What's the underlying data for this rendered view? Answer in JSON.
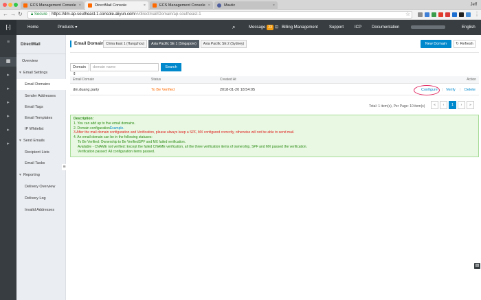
{
  "browser": {
    "tabs": [
      {
        "label": "ECS Management Console",
        "active": false
      },
      {
        "label": "DirectMail Console",
        "active": true
      },
      {
        "label": "ECS Management Console",
        "active": false
      },
      {
        "label": "Mautic",
        "active": false
      }
    ],
    "user": "Jeff",
    "secure_label": "Secure",
    "url_host": "https://dm-ap-southeast-1.console.aliyun.com",
    "url_path": "/#/directmail/Domain/ap-southeast-1"
  },
  "topnav": {
    "home": "Home",
    "products": "Products",
    "message": "Message",
    "message_count": "23",
    "billing": "Billing Management",
    "support": "Support",
    "icp": "ICP",
    "documentation": "Documentation",
    "language": "English"
  },
  "sidebar": {
    "title": "DirectMail",
    "overview": "Overview",
    "email_settings": "Email Settings",
    "email_domains": "Email Domains",
    "sender_addresses": "Sender Addresses",
    "email_tags": "Email Tags",
    "email_templates": "Email Templates",
    "ip_whitelist": "IP Whitelist",
    "send_emails": "Send Emails",
    "recipient_lists": "Recipient Lists",
    "email_tasks": "Email Tasks",
    "reporting": "Reporting",
    "delivery_overview": "Delivery Overview",
    "delivery_log": "Delivery Log",
    "invalid_addresses": "Invalid Addresses"
  },
  "main": {
    "title": "Email Domains",
    "regions": [
      {
        "label": "China East 1 (Hangzhou)",
        "active": false
      },
      {
        "label": "Asia Pacific SE 1 (Singapore)",
        "active": true
      },
      {
        "label": "Asia Pacific SE 2 (Sydney)",
        "active": false
      }
    ],
    "new_domain": "New Domain",
    "refresh": "Refresh",
    "search": {
      "field": "Domain",
      "placeholder": "domain name",
      "value": "",
      "button": "Search"
    },
    "table": {
      "headers": {
        "domain": "Email Domain",
        "status": "Status",
        "created": "Created At",
        "action": "Action"
      },
      "rows": [
        {
          "domain": "dm.duang.party",
          "status": "To Be Verified",
          "created": "2018-01-20 18:54:05",
          "configure": "Configure",
          "verify": "Verify",
          "delete": "Delete"
        }
      ]
    },
    "pagination": {
      "info": "Total: 1 item(s),   Per Page: 10 item(s)",
      "first": "«",
      "prev": "‹",
      "current": "1",
      "next": "›",
      "last": "»"
    },
    "description": {
      "title": "Description:",
      "line1": "1. You can add up to five email domains.",
      "line2_prefix": "2. Domain configuration",
      "line2_link": "Example.",
      "line3": "3.After the mail domain configuration and Verification,   please always keep a SPF, MX configured correctly, otherwise will not be able to send mail.",
      "line4": "4. An email domain can be in the following statuses:",
      "line5": "To Be Verified: Ownership to Be VerifiedSPF and MX failed verification.",
      "line6": "Available - CNAME not verified: Except the failed CNAME verification, all the three verification items of ownership, SPF and MX passed the verification.",
      "line7": "Verification passed: All configuration items passed."
    }
  },
  "colors": {
    "accent": "#0088cc",
    "nav_bg": "#373d41",
    "status_warning": "#ff6a00",
    "highlight_circle": "#e0245e"
  }
}
